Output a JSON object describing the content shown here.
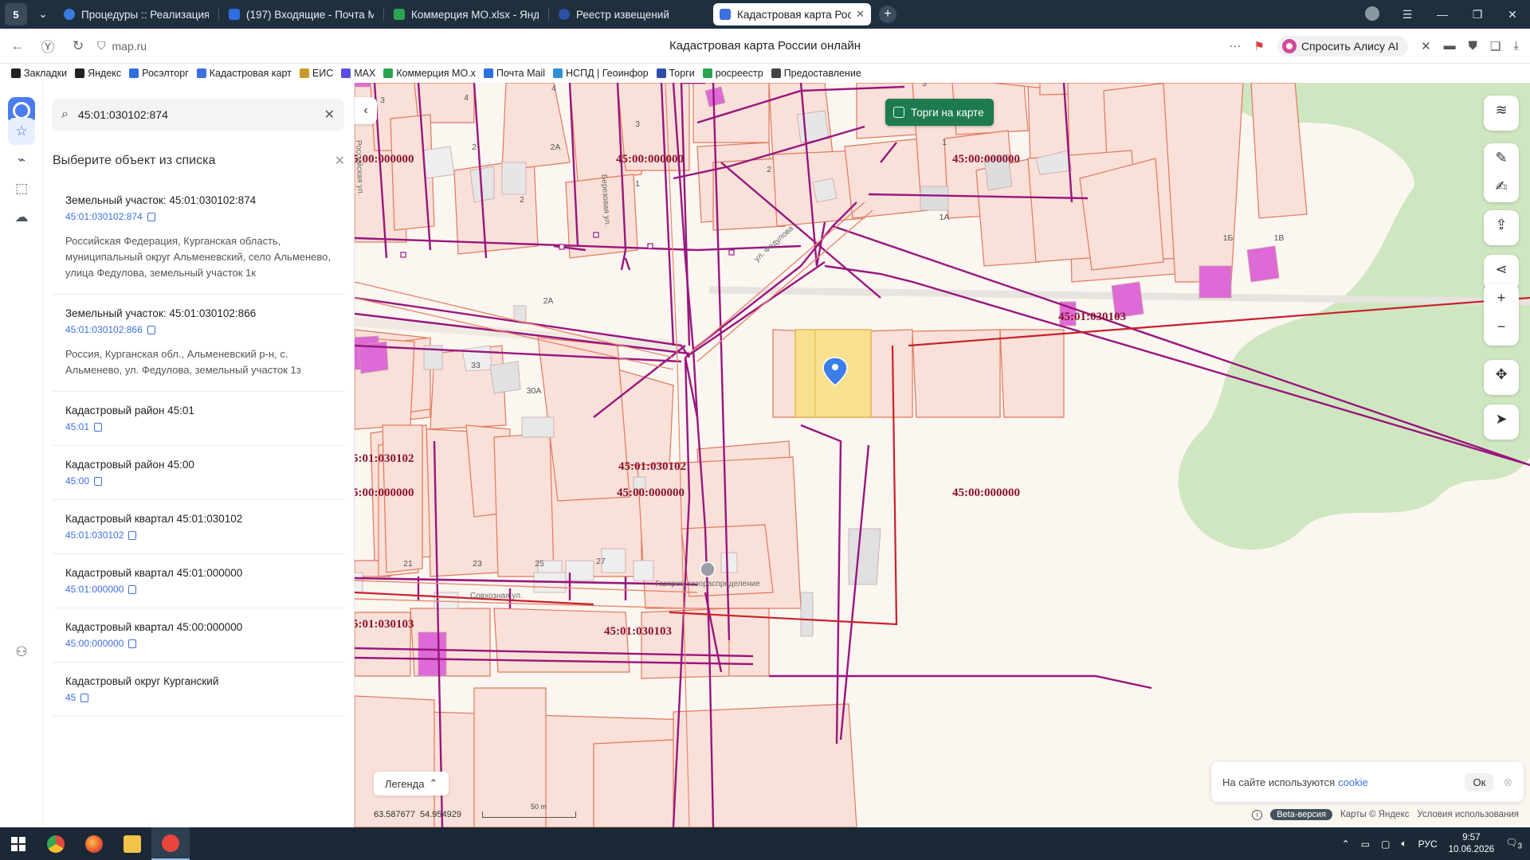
{
  "browser": {
    "tabs": [
      {
        "label": "Процедуры :: Реализация",
        "color": "#3a7be0"
      },
      {
        "label": "(197) Входящие - Почта М",
        "color": "#2f6ee0"
      },
      {
        "label": "Коммерция МО.xlsx - Янд",
        "color": "#2aa44f"
      },
      {
        "label": "Реестр извещений",
        "color": "#2d4fa8"
      },
      {
        "label": "Кадастровая карта Рос",
        "color": "#3c6fe0"
      }
    ],
    "address": "map.ru",
    "page_title": "Кадастровая карта России онлайн",
    "alice_label": "Спросить Алису AI",
    "badge": "5"
  },
  "bookmarks": [
    {
      "label": "Закладки",
      "color": "#222"
    },
    {
      "label": "Яндекс",
      "color": "#222"
    },
    {
      "label": "Росэлторг",
      "color": "#2f6ee0"
    },
    {
      "label": "Кадастровая карт",
      "color": "#3c6fe0"
    },
    {
      "label": "ЕИС",
      "color": "#c79a2a"
    },
    {
      "label": "MAX",
      "color": "#5a4fe0"
    },
    {
      "label": "Коммерция МО.x",
      "color": "#2aa44f"
    },
    {
      "label": "Почта Mail",
      "color": "#2f6ee0"
    },
    {
      "label": "НСПД | Геоинфор",
      "color": "#2c8fd6"
    },
    {
      "label": "Торги",
      "color": "#2d4fa8"
    },
    {
      "label": "росреестр",
      "color": "#2aa44f"
    },
    {
      "label": "Предоставление",
      "color": "#444"
    }
  ],
  "search": {
    "value": "45:01:030102:874",
    "list_title": "Выберите объект из списка"
  },
  "results": [
    {
      "title": "Земельный участок: 45:01:030102:874",
      "number": "45:01:030102:874",
      "address": "Российская Федерация, Курганская область, муниципальный округ Альменевский, село Альменево, улица Федулова, земельный участок 1к"
    },
    {
      "title": "Земельный участок: 45:01:030102:866",
      "number": "45:01:030102:866",
      "address": "Россия, Курганская обл., Альменевский р-н, с. Альменево, ул. Федулова, земельный участок 1з"
    },
    {
      "title": "Кадастровый район 45:01",
      "number": "45:01",
      "address": ""
    },
    {
      "title": "Кадастровый район 45:00",
      "number": "45:00",
      "address": ""
    },
    {
      "title": "Кадастровый квартал 45:01:030102",
      "number": "45:01:030102",
      "address": ""
    },
    {
      "title": "Кадастровый квартал 45:01:000000",
      "number": "45:01:000000",
      "address": ""
    },
    {
      "title": "Кадастровый квартал 45:00:000000",
      "number": "45:00:000000",
      "address": ""
    },
    {
      "title": "Кадастровый округ Курганский",
      "number": "45",
      "address": ""
    }
  ],
  "map": {
    "torgi_label": "Торги на карте",
    "legend_label": "Легенда",
    "coord_lon": "63.587677",
    "coord_lat": "54.954929",
    "scale_label": "50 m",
    "beta_label": "Beta-версия",
    "attribution": "Карты © Яндекс",
    "terms": "Условия использования",
    "cookie_text": "На сайте используются",
    "cookie_link": "cookie",
    "cookie_ok": "Ок",
    "quarter_labels": [
      "5:00:000000",
      "45:00:000000",
      "45:00:000000",
      "45:01:030103",
      "5:01:030102",
      "5:00:000000",
      "45:01:030102",
      "45:00:000000",
      "45:00:000000",
      "5:01:030103",
      "45:01:030103"
    ],
    "house_numbers": [
      "3",
      "4",
      "4",
      "3",
      "3",
      "2",
      "2А",
      "2",
      "1",
      "2",
      "1",
      "1А",
      "1Б",
      "1В",
      "2А",
      "31",
      "33",
      "30А",
      "19",
      "21",
      "23",
      "25",
      "27"
    ],
    "street_labels": [
      "Российская ул.",
      "Березовая ул.",
      "ул. Федулова",
      "Совхозная ул."
    ],
    "poi_label": "Газпром газораспределение",
    "colors": {
      "parcel_fill": "#f9e1d9",
      "parcel_stroke": "#e0775c",
      "boundary": "#99167e",
      "quarter": "#c8202b",
      "selected": "#f8e08e",
      "forest": "#cfe7c0"
    }
  },
  "taskbar": {
    "lang": "РУС",
    "time": "9:57",
    "date": "10.06.2026",
    "notif": "3"
  }
}
